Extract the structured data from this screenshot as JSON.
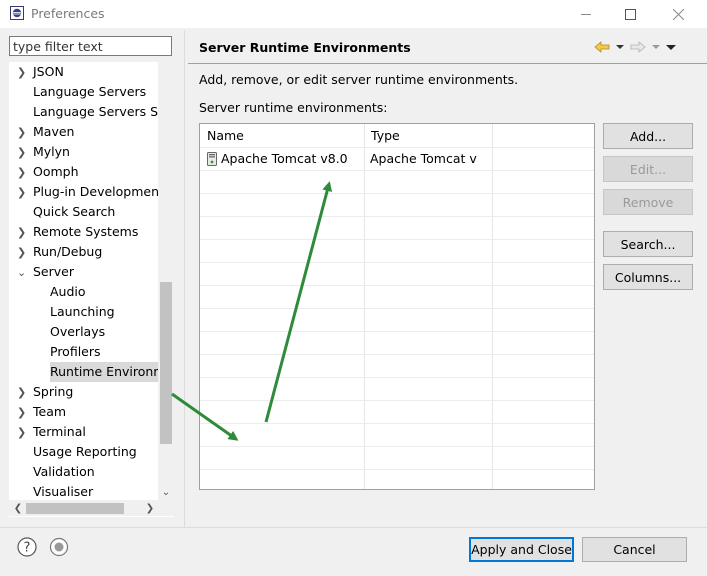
{
  "window": {
    "title": "Preferences"
  },
  "filter": {
    "placeholder": "type filter text"
  },
  "tree": {
    "items": [
      {
        "label": "JSON",
        "expand": ">",
        "indent": 0
      },
      {
        "label": "Language Servers",
        "expand": "",
        "indent": 0
      },
      {
        "label": "Language Servers STS",
        "expand": "",
        "indent": 0
      },
      {
        "label": "Maven",
        "expand": ">",
        "indent": 0
      },
      {
        "label": "Mylyn",
        "expand": ">",
        "indent": 0
      },
      {
        "label": "Oomph",
        "expand": ">",
        "indent": 0
      },
      {
        "label": "Plug-in Development",
        "expand": ">",
        "indent": 0
      },
      {
        "label": "Quick Search",
        "expand": "",
        "indent": 0
      },
      {
        "label": "Remote Systems",
        "expand": ">",
        "indent": 0
      },
      {
        "label": "Run/Debug",
        "expand": ">",
        "indent": 0
      },
      {
        "label": "Server",
        "expand": "v",
        "indent": 0
      },
      {
        "label": "Audio",
        "expand": "",
        "indent": 1
      },
      {
        "label": "Launching",
        "expand": "",
        "indent": 1
      },
      {
        "label": "Overlays",
        "expand": "",
        "indent": 1
      },
      {
        "label": "Profilers",
        "expand": "",
        "indent": 1
      },
      {
        "label": "Runtime Environm",
        "expand": "",
        "indent": 1,
        "selected": true
      },
      {
        "label": "Spring",
        "expand": ">",
        "indent": 0
      },
      {
        "label": "Team",
        "expand": ">",
        "indent": 0
      },
      {
        "label": "Terminal",
        "expand": ">",
        "indent": 0
      },
      {
        "label": "Usage Reporting",
        "expand": "",
        "indent": 0
      },
      {
        "label": "Validation",
        "expand": "",
        "indent": 0
      },
      {
        "label": "Visualiser",
        "expand": "",
        "indent": 0
      }
    ]
  },
  "page": {
    "title": "Server Runtime Environments",
    "description": "Add, remove, or edit server runtime environments.",
    "list_label": "Server runtime environments:"
  },
  "table": {
    "columns": [
      "Name",
      "Type"
    ],
    "rows": [
      {
        "name": "Apache Tomcat v8.0",
        "type": "Apache Tomcat v"
      }
    ]
  },
  "buttons": {
    "add": "Add...",
    "edit": "Edit...",
    "remove": "Remove",
    "search": "Search...",
    "columns": "Columns...",
    "apply_close": "Apply and Close",
    "cancel": "Cancel"
  },
  "colors": {
    "annotation_arrow": "#2e8b3a",
    "accent": "#0078d7"
  }
}
